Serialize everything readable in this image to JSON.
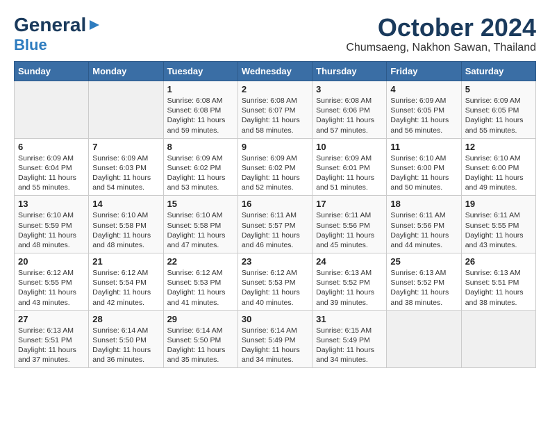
{
  "header": {
    "logo_general": "General",
    "logo_blue": "Blue",
    "month": "October 2024",
    "location": "Chumsaeng, Nakhon Sawan, Thailand"
  },
  "days_of_week": [
    "Sunday",
    "Monday",
    "Tuesday",
    "Wednesday",
    "Thursday",
    "Friday",
    "Saturday"
  ],
  "weeks": [
    [
      {
        "day": "",
        "info": ""
      },
      {
        "day": "",
        "info": ""
      },
      {
        "day": "1",
        "info": "Sunrise: 6:08 AM\nSunset: 6:08 PM\nDaylight: 11 hours and 59 minutes."
      },
      {
        "day": "2",
        "info": "Sunrise: 6:08 AM\nSunset: 6:07 PM\nDaylight: 11 hours and 58 minutes."
      },
      {
        "day": "3",
        "info": "Sunrise: 6:08 AM\nSunset: 6:06 PM\nDaylight: 11 hours and 57 minutes."
      },
      {
        "day": "4",
        "info": "Sunrise: 6:09 AM\nSunset: 6:05 PM\nDaylight: 11 hours and 56 minutes."
      },
      {
        "day": "5",
        "info": "Sunrise: 6:09 AM\nSunset: 6:05 PM\nDaylight: 11 hours and 55 minutes."
      }
    ],
    [
      {
        "day": "6",
        "info": "Sunrise: 6:09 AM\nSunset: 6:04 PM\nDaylight: 11 hours and 55 minutes."
      },
      {
        "day": "7",
        "info": "Sunrise: 6:09 AM\nSunset: 6:03 PM\nDaylight: 11 hours and 54 minutes."
      },
      {
        "day": "8",
        "info": "Sunrise: 6:09 AM\nSunset: 6:02 PM\nDaylight: 11 hours and 53 minutes."
      },
      {
        "day": "9",
        "info": "Sunrise: 6:09 AM\nSunset: 6:02 PM\nDaylight: 11 hours and 52 minutes."
      },
      {
        "day": "10",
        "info": "Sunrise: 6:09 AM\nSunset: 6:01 PM\nDaylight: 11 hours and 51 minutes."
      },
      {
        "day": "11",
        "info": "Sunrise: 6:10 AM\nSunset: 6:00 PM\nDaylight: 11 hours and 50 minutes."
      },
      {
        "day": "12",
        "info": "Sunrise: 6:10 AM\nSunset: 6:00 PM\nDaylight: 11 hours and 49 minutes."
      }
    ],
    [
      {
        "day": "13",
        "info": "Sunrise: 6:10 AM\nSunset: 5:59 PM\nDaylight: 11 hours and 48 minutes."
      },
      {
        "day": "14",
        "info": "Sunrise: 6:10 AM\nSunset: 5:58 PM\nDaylight: 11 hours and 48 minutes."
      },
      {
        "day": "15",
        "info": "Sunrise: 6:10 AM\nSunset: 5:58 PM\nDaylight: 11 hours and 47 minutes."
      },
      {
        "day": "16",
        "info": "Sunrise: 6:11 AM\nSunset: 5:57 PM\nDaylight: 11 hours and 46 minutes."
      },
      {
        "day": "17",
        "info": "Sunrise: 6:11 AM\nSunset: 5:56 PM\nDaylight: 11 hours and 45 minutes."
      },
      {
        "day": "18",
        "info": "Sunrise: 6:11 AM\nSunset: 5:56 PM\nDaylight: 11 hours and 44 minutes."
      },
      {
        "day": "19",
        "info": "Sunrise: 6:11 AM\nSunset: 5:55 PM\nDaylight: 11 hours and 43 minutes."
      }
    ],
    [
      {
        "day": "20",
        "info": "Sunrise: 6:12 AM\nSunset: 5:55 PM\nDaylight: 11 hours and 43 minutes."
      },
      {
        "day": "21",
        "info": "Sunrise: 6:12 AM\nSunset: 5:54 PM\nDaylight: 11 hours and 42 minutes."
      },
      {
        "day": "22",
        "info": "Sunrise: 6:12 AM\nSunset: 5:53 PM\nDaylight: 11 hours and 41 minutes."
      },
      {
        "day": "23",
        "info": "Sunrise: 6:12 AM\nSunset: 5:53 PM\nDaylight: 11 hours and 40 minutes."
      },
      {
        "day": "24",
        "info": "Sunrise: 6:13 AM\nSunset: 5:52 PM\nDaylight: 11 hours and 39 minutes."
      },
      {
        "day": "25",
        "info": "Sunrise: 6:13 AM\nSunset: 5:52 PM\nDaylight: 11 hours and 38 minutes."
      },
      {
        "day": "26",
        "info": "Sunrise: 6:13 AM\nSunset: 5:51 PM\nDaylight: 11 hours and 38 minutes."
      }
    ],
    [
      {
        "day": "27",
        "info": "Sunrise: 6:13 AM\nSunset: 5:51 PM\nDaylight: 11 hours and 37 minutes."
      },
      {
        "day": "28",
        "info": "Sunrise: 6:14 AM\nSunset: 5:50 PM\nDaylight: 11 hours and 36 minutes."
      },
      {
        "day": "29",
        "info": "Sunrise: 6:14 AM\nSunset: 5:50 PM\nDaylight: 11 hours and 35 minutes."
      },
      {
        "day": "30",
        "info": "Sunrise: 6:14 AM\nSunset: 5:49 PM\nDaylight: 11 hours and 34 minutes."
      },
      {
        "day": "31",
        "info": "Sunrise: 6:15 AM\nSunset: 5:49 PM\nDaylight: 11 hours and 34 minutes."
      },
      {
        "day": "",
        "info": ""
      },
      {
        "day": "",
        "info": ""
      }
    ]
  ]
}
